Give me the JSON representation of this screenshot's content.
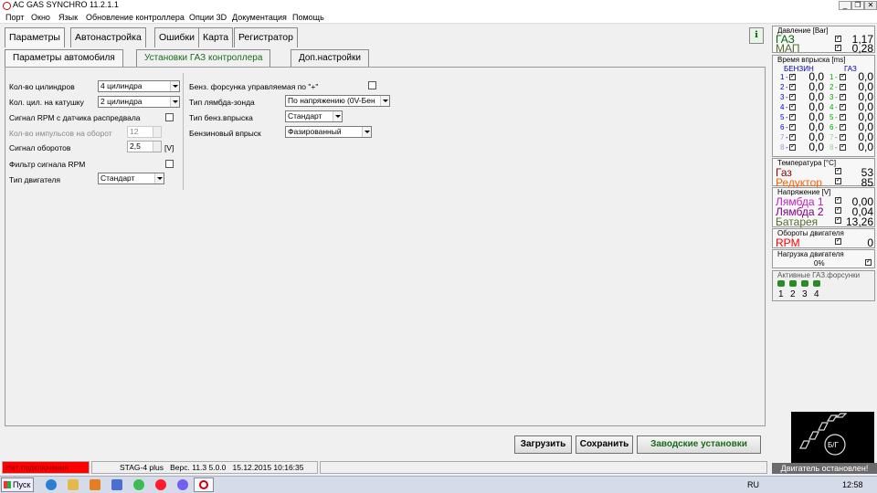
{
  "window": {
    "title": "AC GAS SYNCHRO  11.2.1.1"
  },
  "menu": [
    "Порт",
    "Окно",
    "Язык",
    "Обновление контроллера",
    "Опции 3D",
    "Документация",
    "Помощь"
  ],
  "tabs": [
    "Параметры",
    "Автонастройка",
    "Ошибки",
    "Карта",
    "Регистратор"
  ],
  "subtabs": [
    "Параметры автомобиля",
    "Установки ГАЗ контроллера",
    "Доп.настройки"
  ],
  "left": {
    "cyl_label": "Кол-во цилиндров",
    "cyl_value": "4 цилиндра",
    "coil_label": "Кол. цил. на катушку",
    "coil_value": "2 цилиндра",
    "rpm_cam_label": "Сигнал RPM с датчика распредвала",
    "pulses_label": "Кол-во импульсов на оборот",
    "pulses_value": "12",
    "rpm_signal_label": "Сигнал оборотов",
    "rpm_signal_value": "2,5",
    "rpm_signal_unit": "[V]",
    "rpm_filter_label": "Фильтр сигнала RPM",
    "engine_type_label": "Тип двигателя",
    "engine_type_value": "Стандарт"
  },
  "mid": {
    "petrol_inj_label": "Бенз. форсунка управляемая по \"+\"",
    "lambda_type_label": "Тип лямбда-зонда",
    "lambda_type_value": "По напряжению  (0V-Бен",
    "petrol_inj_type_label": "Тип бенз.впрыска",
    "petrol_inj_type_value": "Стандарт",
    "petrol_inj_mode_label": "Бензиновый впрыск",
    "petrol_inj_mode_value": "Фазированный"
  },
  "buttons": {
    "load": "Загрузить",
    "save": "Сохранить",
    "factory": "Заводские установки"
  },
  "status": {
    "conn": "Нет подключения",
    "device": "STAG-4 plus",
    "version": "Верс.  11.3  5.0.0",
    "datetime": "15.12.2015 10:16:35"
  },
  "right": {
    "pressure_title": "Давление [Bar]",
    "gas_label": "ГАЗ",
    "gas_value": "1,17",
    "map_label": "МАП",
    "map_value": "0,28",
    "inj_title": "Время впрыска [ms]",
    "col_petrol": "БЕНЗИН",
    "col_gas": "ГАЗ",
    "inj_rows": [
      {
        "n": "1",
        "p": "0,0",
        "g": "0,0"
      },
      {
        "n": "2",
        "p": "0,0",
        "g": "0,0"
      },
      {
        "n": "3",
        "p": "0,0",
        "g": "0,0"
      },
      {
        "n": "4",
        "p": "0,0",
        "g": "0,0"
      },
      {
        "n": "5",
        "p": "0,0",
        "g": "0,0"
      },
      {
        "n": "6",
        "p": "0,0",
        "g": "0,0"
      },
      {
        "n": "7",
        "p": "0,0",
        "g": "0,0"
      },
      {
        "n": "8",
        "p": "0,0",
        "g": "0,0"
      }
    ],
    "temp_title": "Температура  [°C]",
    "temp_gas_label": "Газ",
    "temp_gas_value": "53",
    "temp_red_label": "Редуктор",
    "temp_red_value": "85",
    "volt_title": "Напряжение [V]",
    "l1_label": "Лямбда 1",
    "l1_value": "0,00",
    "l2_label": "Лямбда 2",
    "l2_value": "0,04",
    "bat_label": "Батарея",
    "bat_value": "13,26",
    "rpm_title": "Обороты двигателя",
    "rpm_label": "RPM",
    "rpm_value": "0",
    "load_title": "Нагрузка двигателя",
    "load_value": "0%",
    "active_inj_title": "Активные ГАЗ.форсунки",
    "active_inj": [
      "1",
      "2",
      "3",
      "4"
    ],
    "engine_badge": "Б/Г",
    "engine_msg": "Двигатель остановлен!"
  },
  "taskbar": {
    "start": "Пуск",
    "lang": "RU",
    "time": "12:58"
  },
  "colors": {
    "gas": "#006400",
    "map": "#556b2f",
    "lambda": "#c020c0",
    "reductor": "#ff6000",
    "rpm": "#ff0000",
    "status_err": "#ff0000"
  }
}
